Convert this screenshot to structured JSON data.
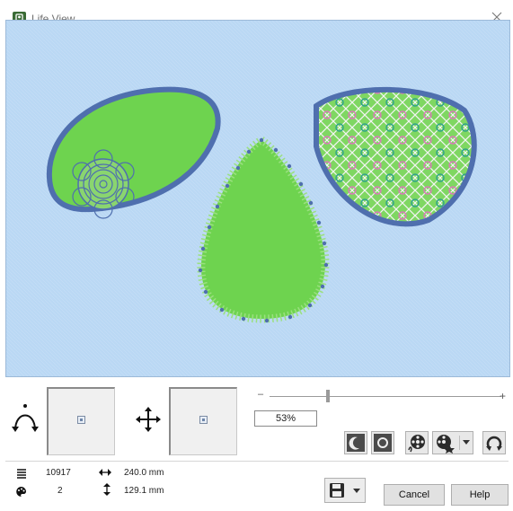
{
  "window": {
    "title": "Life View"
  },
  "icons": {
    "app": "app-embroidery-icon",
    "close": "close-icon",
    "rotate_3d": "rotate-3d-icon",
    "move": "move-arrows-icon",
    "night": "moon-icon",
    "day": "sun-icon",
    "stitch_player": "stitch-player-icon",
    "stitch_player_options": "stitch-player-options-icon",
    "reset": "reset-view-icon",
    "save": "save-icon",
    "stitches": "stitch-count-icon",
    "colors": "color-palette-icon",
    "width": "width-arrows-icon",
    "height": "height-arrows-icon"
  },
  "zoom": {
    "minus": "–",
    "plus": "+",
    "value": "53%",
    "level": 0.25
  },
  "stats": {
    "stitches": "10917",
    "colors": "2",
    "width": "240.0 mm",
    "height": "129.1 mm"
  },
  "buttons": {
    "cancel": "Cancel",
    "help": "Help"
  },
  "colors": {
    "background_fabric": "#bad8f4",
    "petal_fill": "#6ed34f",
    "border_stitch": "#4f6fae",
    "cross_stitch_pink": "#d97ab8",
    "cross_stitch_teal": "#2fa38a"
  }
}
